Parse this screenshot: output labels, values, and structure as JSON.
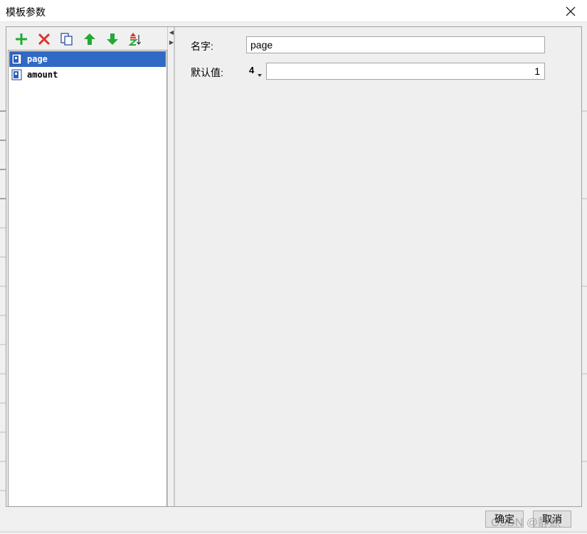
{
  "window": {
    "title": "模板参数",
    "close_icon": "close-icon"
  },
  "toolbar": {
    "buttons": [
      {
        "name": "add",
        "icon": "plus-icon",
        "color": "#22aa33"
      },
      {
        "name": "delete",
        "icon": "x-icon",
        "color": "#e03030"
      },
      {
        "name": "copy",
        "icon": "copy-icon",
        "color": "#2a4fa8"
      },
      {
        "name": "move-up",
        "icon": "arrow-up-icon",
        "color": "#22aa33"
      },
      {
        "name": "move-down",
        "icon": "arrow-down-icon",
        "color": "#22aa33"
      },
      {
        "name": "sort",
        "icon": "sort-az-icon",
        "color": "#22aa33"
      }
    ]
  },
  "parameters": [
    {
      "label": "page",
      "selected": true
    },
    {
      "label": "amount",
      "selected": false
    }
  ],
  "form": {
    "name_label": "名字:",
    "name_value": "page",
    "default_label": "默认值:",
    "type_value": "4",
    "default_value": "1"
  },
  "footer": {
    "ok_label": "确定",
    "cancel_label": "取消",
    "watermark": "CSDN @静默"
  },
  "colors": {
    "selection": "#316ac5",
    "accent_green": "#22aa33",
    "accent_red": "#e03030"
  }
}
